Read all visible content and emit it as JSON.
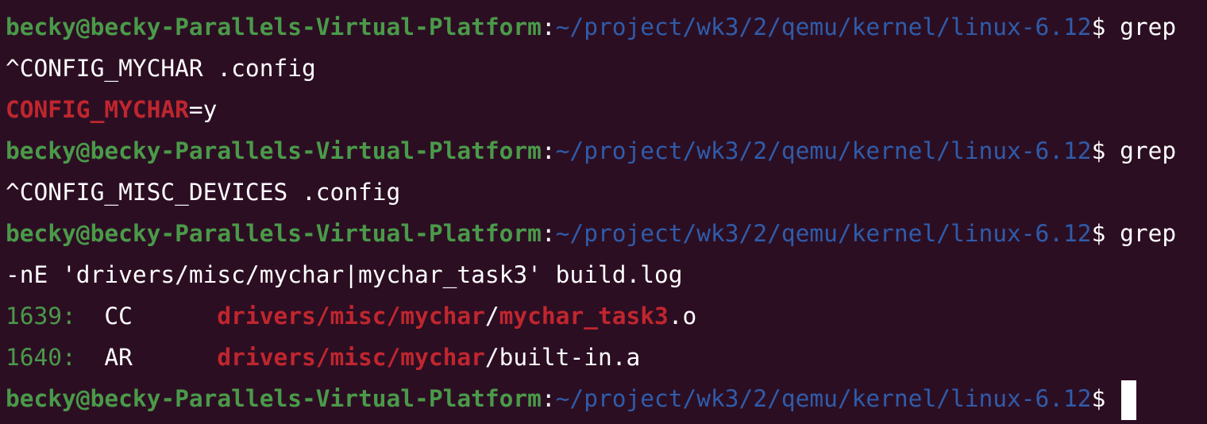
{
  "colors": {
    "background": "#2c0e23",
    "prompt_user": "#4a9a49",
    "prompt_path": "#2f5caa",
    "match_red": "#c0262e",
    "line_number": "#4a9a49",
    "text": "#ffffff"
  },
  "prompt": {
    "user_host": "becky@becky-Parallels-Virtual-Platform",
    "colon": ":",
    "path": "~/project/wk3/2/qemu/kernel/linux-6.12",
    "dollar": "$ "
  },
  "lines": {
    "l1_cmd": "grep",
    "l2_text": "^CONFIG_MYCHAR .config",
    "l3_match": "CONFIG_MYCHAR",
    "l3_rest": "=y",
    "l4_cmd": "grep",
    "l5_text": "^CONFIG_MISC_DEVICES .config",
    "l6_cmd": "grep",
    "l7_text": "-nE 'drivers/misc/mychar|mychar_task3' build.log",
    "l8_num": "1639:",
    "l8_op": "  CC      ",
    "l8_m1": "drivers/misc/mychar",
    "l8_slash": "/",
    "l8_m2": "mychar_task3",
    "l8_rest": ".o",
    "l9_num": "1640:",
    "l9_op": "  AR      ",
    "l9_m1": "drivers/misc/mychar",
    "l9_rest": "/built-in.a"
  }
}
